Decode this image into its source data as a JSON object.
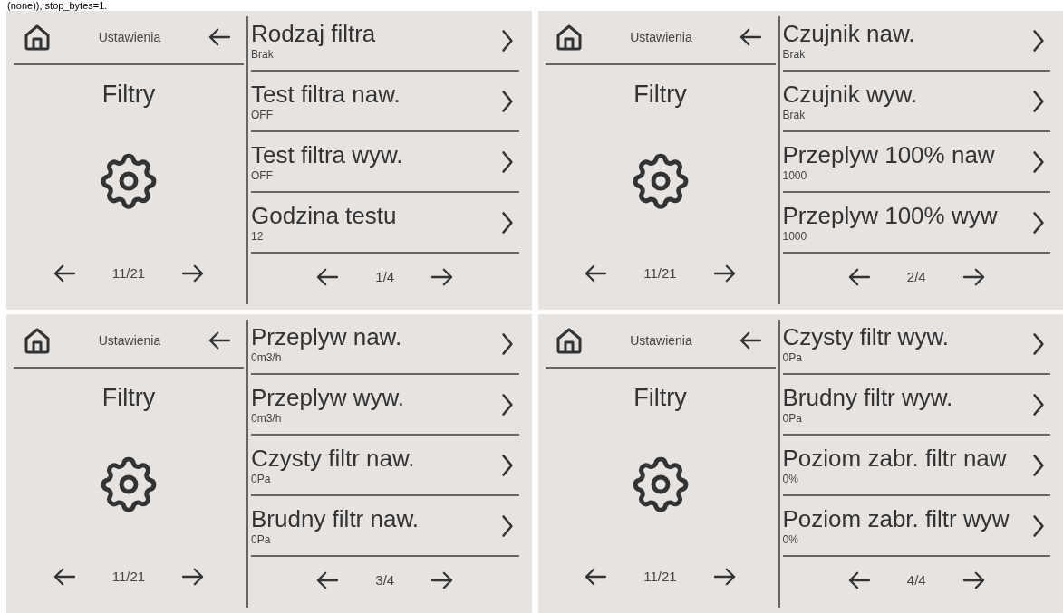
{
  "top_text": "(none)), stop_bytes=1.",
  "panels": [
    {
      "header_title": "Ustawienia",
      "section_title": "Filtry",
      "section_pager": "11/21",
      "items_pager": "1/4",
      "items": [
        {
          "label": "Rodzaj filtra",
          "value": "Brak"
        },
        {
          "label": "Test filtra naw.",
          "value": "OFF"
        },
        {
          "label": "Test filtra wyw.",
          "value": "OFF"
        },
        {
          "label": "Godzina testu",
          "value": "12"
        }
      ]
    },
    {
      "header_title": "Ustawienia",
      "section_title": "Filtry",
      "section_pager": "11/21",
      "items_pager": "2/4",
      "items": [
        {
          "label": "Czujnik naw.",
          "value": "Brak"
        },
        {
          "label": "Czujnik wyw.",
          "value": "Brak"
        },
        {
          "label": "Przeplyw 100% naw",
          "value": "1000"
        },
        {
          "label": "Przeplyw 100% wyw",
          "value": "1000"
        }
      ]
    },
    {
      "header_title": "Ustawienia",
      "section_title": "Filtry",
      "section_pager": "11/21",
      "items_pager": "3/4",
      "items": [
        {
          "label": "Przeplyw naw.",
          "value": "0m3/h"
        },
        {
          "label": "Przeplyw wyw.",
          "value": "0m3/h"
        },
        {
          "label": "Czysty filtr naw.",
          "value": "0Pa"
        },
        {
          "label": "Brudny filtr naw.",
          "value": "0Pa"
        }
      ]
    },
    {
      "header_title": "Ustawienia",
      "section_title": "Filtry",
      "section_pager": "11/21",
      "items_pager": "4/4",
      "items": [
        {
          "label": "Czysty filtr wyw.",
          "value": "0Pa"
        },
        {
          "label": "Brudny filtr wyw.",
          "value": "0Pa"
        },
        {
          "label": "Poziom zabr. filtr naw",
          "value": "0%"
        },
        {
          "label": "Poziom zabr. filtr wyw",
          "value": "0%"
        }
      ]
    }
  ]
}
